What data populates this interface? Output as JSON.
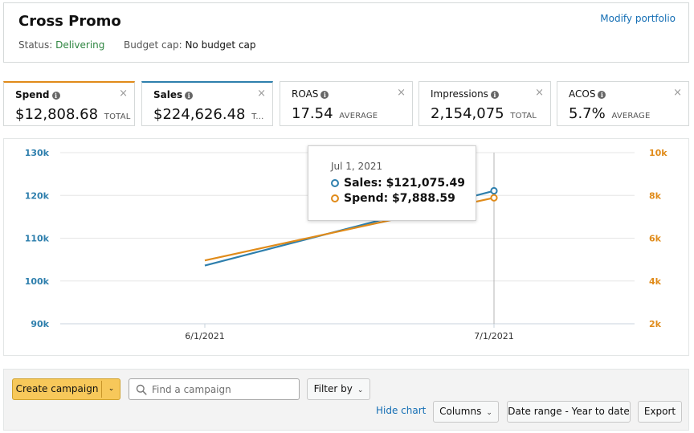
{
  "header": {
    "title": "Cross Promo",
    "modify_link": "Modify portfolio",
    "status_label": "Status:",
    "status_value": "Delivering",
    "budget_label": "Budget cap:",
    "budget_value": "No budget cap"
  },
  "metric_cards": [
    {
      "label": "Spend",
      "value": "$12,808.68",
      "suffix": "TOTAL",
      "active_color": "#e08b1a"
    },
    {
      "label": "Sales",
      "value": "$224,626.48",
      "suffix": "T...",
      "active_color": "#2e7fad"
    },
    {
      "label": "ROAS",
      "value": "17.54",
      "suffix": "AVERAGE"
    },
    {
      "label": "Impressions",
      "value": "2,154,075",
      "suffix": "TOTAL"
    },
    {
      "label": "ACOS",
      "value": "5.7%",
      "suffix": "AVERAGE"
    }
  ],
  "close_glyph": "×",
  "info_glyph": "i",
  "colors": {
    "sales": "#2e7fad",
    "spend": "#e08b1a",
    "primary_button": "#f7c85a",
    "link": "#146eb4",
    "status_green": "#2e8540"
  },
  "chart_data": {
    "type": "line",
    "x": [
      "6/1/2021",
      "7/1/2021"
    ],
    "x_ticks": [
      "6/1/2021",
      "7/1/2021"
    ],
    "y_left": {
      "ticks": [
        "130k",
        "120k",
        "110k",
        "100k",
        "90k"
      ],
      "range": [
        90000,
        130000
      ]
    },
    "y_right": {
      "ticks": [
        "10k",
        "8k",
        "6k",
        "4k",
        "2k"
      ],
      "range": [
        2000,
        10000
      ]
    },
    "series": [
      {
        "name": "Sales",
        "axis": "left",
        "color": "#2e7fad",
        "values": [
          103600,
          121075.49
        ]
      },
      {
        "name": "Spend",
        "axis": "right",
        "color": "#e08b1a",
        "values": [
          4960,
          7888.59
        ]
      }
    ],
    "grid": true,
    "tooltip": {
      "date": "Jul 1, 2021",
      "sales_text": "Sales: $121,075.49",
      "spend_text": "Spend: $7,888.59"
    }
  },
  "toolbar": {
    "create_campaign": "Create campaign",
    "caret_glyph": "⌄",
    "search_placeholder": "Find a campaign",
    "search_value": "",
    "filter_by": "Filter by",
    "hide_chart": "Hide chart",
    "columns": "Columns",
    "date_range": "Date range - Year to date",
    "export": "Export"
  }
}
